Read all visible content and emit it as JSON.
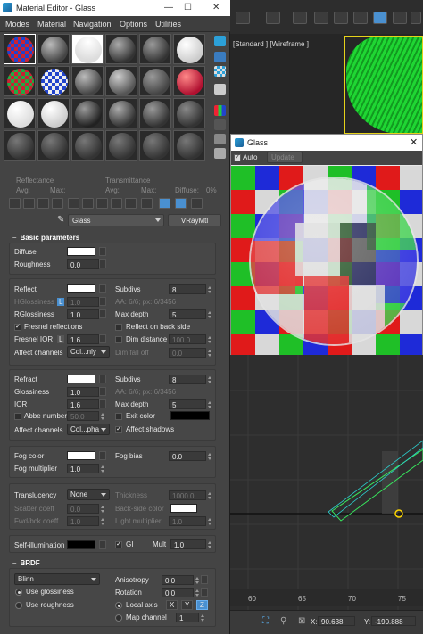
{
  "material_editor": {
    "title": "Material Editor - Glass",
    "menu": [
      "Modes",
      "Material",
      "Navigation",
      "Options",
      "Utilities"
    ],
    "header": {
      "reflectance": "Reflectance",
      "transmittance": "Transmittance",
      "avg1": "Avg:",
      "max1": "Max:",
      "avg2": "Avg:",
      "max2": "Max:",
      "diffuse": "Diffuse:",
      "diffuse_value": "0%"
    },
    "material_name": "Glass",
    "material_type": "VRayMtl",
    "basic": {
      "title": "Basic parameters",
      "diffuse": "Diffuse",
      "roughness": "Roughness",
      "roughness_value": "0.0",
      "reflect": "Reflect",
      "hglossiness": "HGlossiness",
      "hglossiness_value": "1.0",
      "lock": "L",
      "rglossiness": "RGlossiness",
      "rglossiness_value": "1.0",
      "fresnel_reflections": "Fresnel reflections",
      "fresnel_ior": "Fresnel IOR",
      "fresnel_ior_value": "1.6",
      "affect_channels": "Affect channels",
      "affect_channels_value": "Col...nly",
      "subdivs": "Subdivs",
      "subdivs_value": "8",
      "aa": "AA: 6/6; px: 6/3456",
      "max_depth": "Max depth",
      "max_depth_value": "5",
      "reflect_on_back": "Reflect on back side",
      "dim_distance": "Dim distance",
      "dim_distance_value": "100.0",
      "dim_falloff": "Dim fall off",
      "dim_falloff_value": "0.0",
      "refract": "Refract",
      "glossiness": "Glossiness",
      "glossiness_value": "1.0",
      "ior": "IOR",
      "ior_value": "1.6",
      "abbe": "Abbe number",
      "abbe_value": "50.0",
      "affect_channels2_value": "Col...pha",
      "subdivs2_value": "8",
      "aa2": "AA: 6/6; px: 6/3456",
      "max_depth2_value": "5",
      "exit_color": "Exit color",
      "affect_shadows": "Affect shadows",
      "fog_color": "Fog color",
      "fog_multiplier": "Fog multiplier",
      "fog_multiplier_value": "1.0",
      "fog_bias": "Fog bias",
      "fog_bias_value": "0.0",
      "translucency": "Translucency",
      "translucency_value": "None",
      "scatter_coeff": "Scatter coeff",
      "scatter_coeff_value": "0.0",
      "fwd_bck_coeff": "Fwd/bck coeff",
      "fwd_bck_coeff_value": "1.0",
      "thickness": "Thickness",
      "thickness_value": "1000.0",
      "backside_color": "Back-side color",
      "light_multiplier": "Light multiplier",
      "light_multiplier_value": "1.0",
      "self_illumination": "Self-illumination",
      "gi": "GI",
      "mult": "Mult",
      "mult_value": "1.0"
    },
    "brdf": {
      "title": "BRDF",
      "type": "Blinn",
      "use_glossiness": "Use glossiness",
      "use_roughness": "Use roughness",
      "anisotropy": "Anisotropy",
      "anisotropy_value": "0.0",
      "rotation": "Rotation",
      "rotation_value": "0.0",
      "local_axis": "Local axis",
      "axis_x": "X",
      "axis_y": "Y",
      "axis_z": "Z",
      "map_channel": "Map channel",
      "map_channel_value": "1"
    }
  },
  "viewport": {
    "label": "[Standard ] [Wireframe ]",
    "ruler": [
      "60",
      "65",
      "70",
      "75"
    ],
    "status_x_label": "X:",
    "status_x": "90.638",
    "status_y_label": "Y:",
    "status_y": "-190.888"
  },
  "glass_window": {
    "title": "Glass",
    "auto": "Auto",
    "update": "Update"
  },
  "colors": {
    "accent": "#2ca0d8",
    "selection": "#4a90d0"
  }
}
